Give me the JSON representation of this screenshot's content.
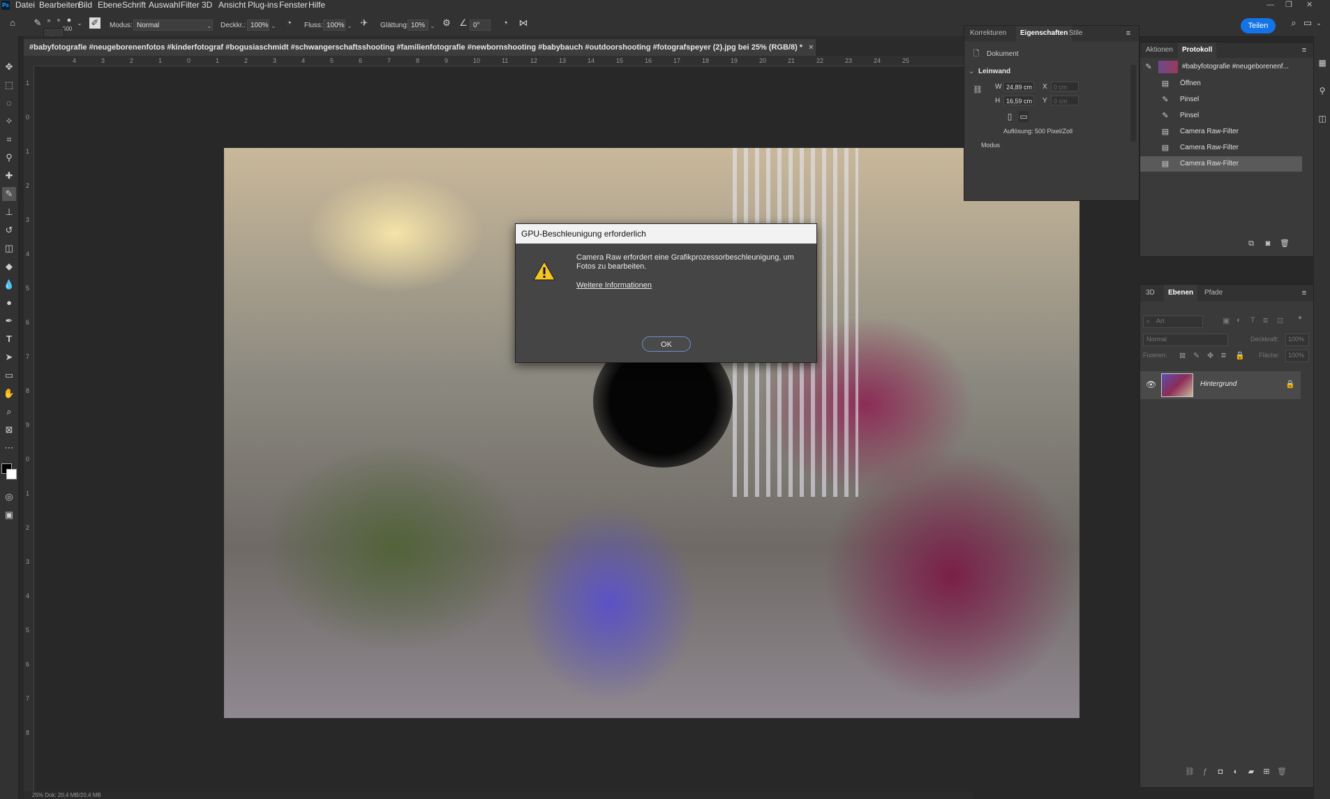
{
  "menu": {
    "logo": "Ps",
    "items": [
      "Datei",
      "Bearbeiten",
      "Bild",
      "Ebene",
      "Schrift",
      "Auswahl",
      "Filter",
      "3D",
      "Ansicht",
      "Plug-ins",
      "Fenster",
      "Hilfe"
    ]
  },
  "options": {
    "brush_size": "500",
    "mode_label": "Modus:",
    "mode_value": "Normal",
    "opacity_label": "Deckkr.:",
    "opacity_value": "100%",
    "flow_label": "Fluss:",
    "flow_value": "100%",
    "smoothing_label": "Glättung:",
    "smoothing_value": "10%",
    "angle_value": "0°",
    "share_label": "Teilen"
  },
  "document": {
    "tab_title": "#babyfotografie #neugeborenenfotos #kinderfotograf #bogusiaschmidt #schwangerschaftsshooting #familienfotografie #newbornshooting #babybauch #outdoorshooting #fotografspeyer (2).jpg bei 25% (RGB/8) *",
    "tab_close": "×",
    "status": "25%     Dok: 20,4 MB/20,4 MB"
  },
  "ruler": {
    "top_ticks": [
      "4",
      "3",
      "2",
      "1",
      "0",
      "1",
      "2",
      "3",
      "4",
      "5",
      "6",
      "7",
      "8",
      "9",
      "10",
      "11",
      "12",
      "13",
      "14",
      "15",
      "16",
      "17",
      "18",
      "19",
      "20",
      "21",
      "22",
      "23",
      "24",
      "25"
    ],
    "left_ticks": [
      "1",
      "0",
      "1",
      "2",
      "3",
      "4",
      "5",
      "6",
      "7",
      "8",
      "9",
      "0",
      "1",
      "2",
      "3",
      "4",
      "5",
      "6",
      "7",
      "8"
    ]
  },
  "dialog": {
    "title": "GPU-Beschleunigung erforderlich",
    "message": "Camera Raw erfordert eine Grafikprozessorbeschleunigung, um Fotos zu bearbeiten.",
    "link": "Weitere Informationen",
    "ok": "OK"
  },
  "properties": {
    "tabs": [
      "Korrekturen",
      "Eigenschaften",
      "Stile"
    ],
    "active_tab": 1,
    "doc_label": "Dokument",
    "section": "Leinwand",
    "w_label": "W",
    "w_value": "24,89 cm",
    "h_label": "H",
    "h_value": "16,59 cm",
    "x_label": "X",
    "x_value": "0 cm",
    "y_label": "Y",
    "y_value": "0 cm",
    "resolution": "Auflösung: 500 Pixel/Zoll",
    "mode_label": "Modus"
  },
  "history": {
    "tabs": [
      "Aktionen",
      "Protokoll"
    ],
    "active_tab": 1,
    "snapshot": "#babyfotografie #neugeborenenf...",
    "items": [
      {
        "label": "Öffnen",
        "icon": "doc-icon"
      },
      {
        "label": "Pinsel",
        "icon": "brush-icon"
      },
      {
        "label": "Pinsel",
        "icon": "brush-icon"
      },
      {
        "label": "Camera Raw-Filter",
        "icon": "doc-icon"
      },
      {
        "label": "Camera Raw-Filter",
        "icon": "doc-icon"
      },
      {
        "label": "Camera Raw-Filter",
        "icon": "doc-icon",
        "selected": true
      }
    ]
  },
  "layers": {
    "tabs": [
      "3D",
      "Ebenen",
      "Pfade"
    ],
    "active_tab": 1,
    "filter_placeholder": "Art",
    "blend_mode": "Normal",
    "opacity_label": "Deckkraft:",
    "opacity_value": "100%",
    "lock_label": "Fixieren:",
    "fill_label": "Fläche:",
    "fill_value": "100%",
    "layer_name": "Hintergrund"
  },
  "colors": {
    "accent": "#1473e6",
    "ok_border": "#6a8fd1"
  }
}
